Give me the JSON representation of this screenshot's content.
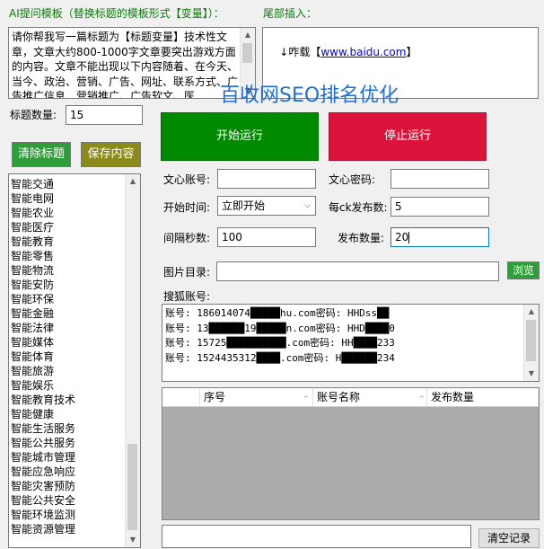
{
  "prompt_template": {
    "label": "AI提问模板（替换标题的模板形式【变量】）：",
    "text": "请你帮我写一篇标题为【标题变量】技术性文章，文章大约800-1000字文章要突出游戏方面的内容。文章不能出现以下内容随着、在今天、当今、政治、营销、广告、网址、联系方式、广告推广信息、营销推广、广告软文、医"
  },
  "tail_insert": {
    "label": "尾部插入：",
    "prefix": "↓咋载【",
    "link": "www.baidu.com",
    "suffix": "】"
  },
  "watermark": "百收网SEO排名优化",
  "title_count": {
    "label": "标题数量:",
    "value": "15"
  },
  "buttons": {
    "start": "开始运行",
    "stop": "停止运行",
    "clear_titles": "清除标题",
    "save_content": "保存内容",
    "browse": "浏览",
    "clear_log": "清空记录"
  },
  "colors": {
    "start": "#008a00",
    "stop": "#dc143c",
    "clear_titles": "#2e9d3a",
    "save_content": "#8b8b1a",
    "browse": "#2e9d3a"
  },
  "fields": {
    "wenxin_account": {
      "label": "文心账号:",
      "value": ""
    },
    "wenxin_password": {
      "label": "文心密码:",
      "value": ""
    },
    "start_time": {
      "label": "开始时间:",
      "value": "立即开始"
    },
    "per_ck": {
      "label": "每ck发布数:",
      "value": "5"
    },
    "interval": {
      "label": "间隔秒数:",
      "value": "100"
    },
    "publish_count": {
      "label": "发布数量:",
      "value": "20"
    },
    "image_dir": {
      "label": "图片目录:",
      "value": ""
    },
    "sohu_accounts_label": "搜狐账号:"
  },
  "sohu_accounts": [
    "账号: 186014074█████hu.com密码: HHDss██",
    "账号: 13██████19█████n.com密码: HHD████0",
    "账号: 15725██████████.com密码: HH████233",
    "账号: 1524435312████.com密码: H██████234"
  ],
  "titles": [
    "智能交通",
    "智能电网",
    "智能农业",
    "智能医疗",
    "智能教育",
    "智能零售",
    "智能物流",
    "智能安防",
    "智能环保",
    "智能金融",
    "智能法律",
    "智能媒体",
    "智能体育",
    "智能旅游",
    "智能娱乐",
    "智能教育技术",
    "智能健康",
    "智能生活服务",
    "智能公共服务",
    "智能城市管理",
    "智能应急响应",
    "智能灾害预防",
    "智能公共安全",
    "智能环境监测",
    "智能资源管理"
  ],
  "table": {
    "columns": [
      "序号",
      "账号名称",
      "发布数量"
    ]
  }
}
